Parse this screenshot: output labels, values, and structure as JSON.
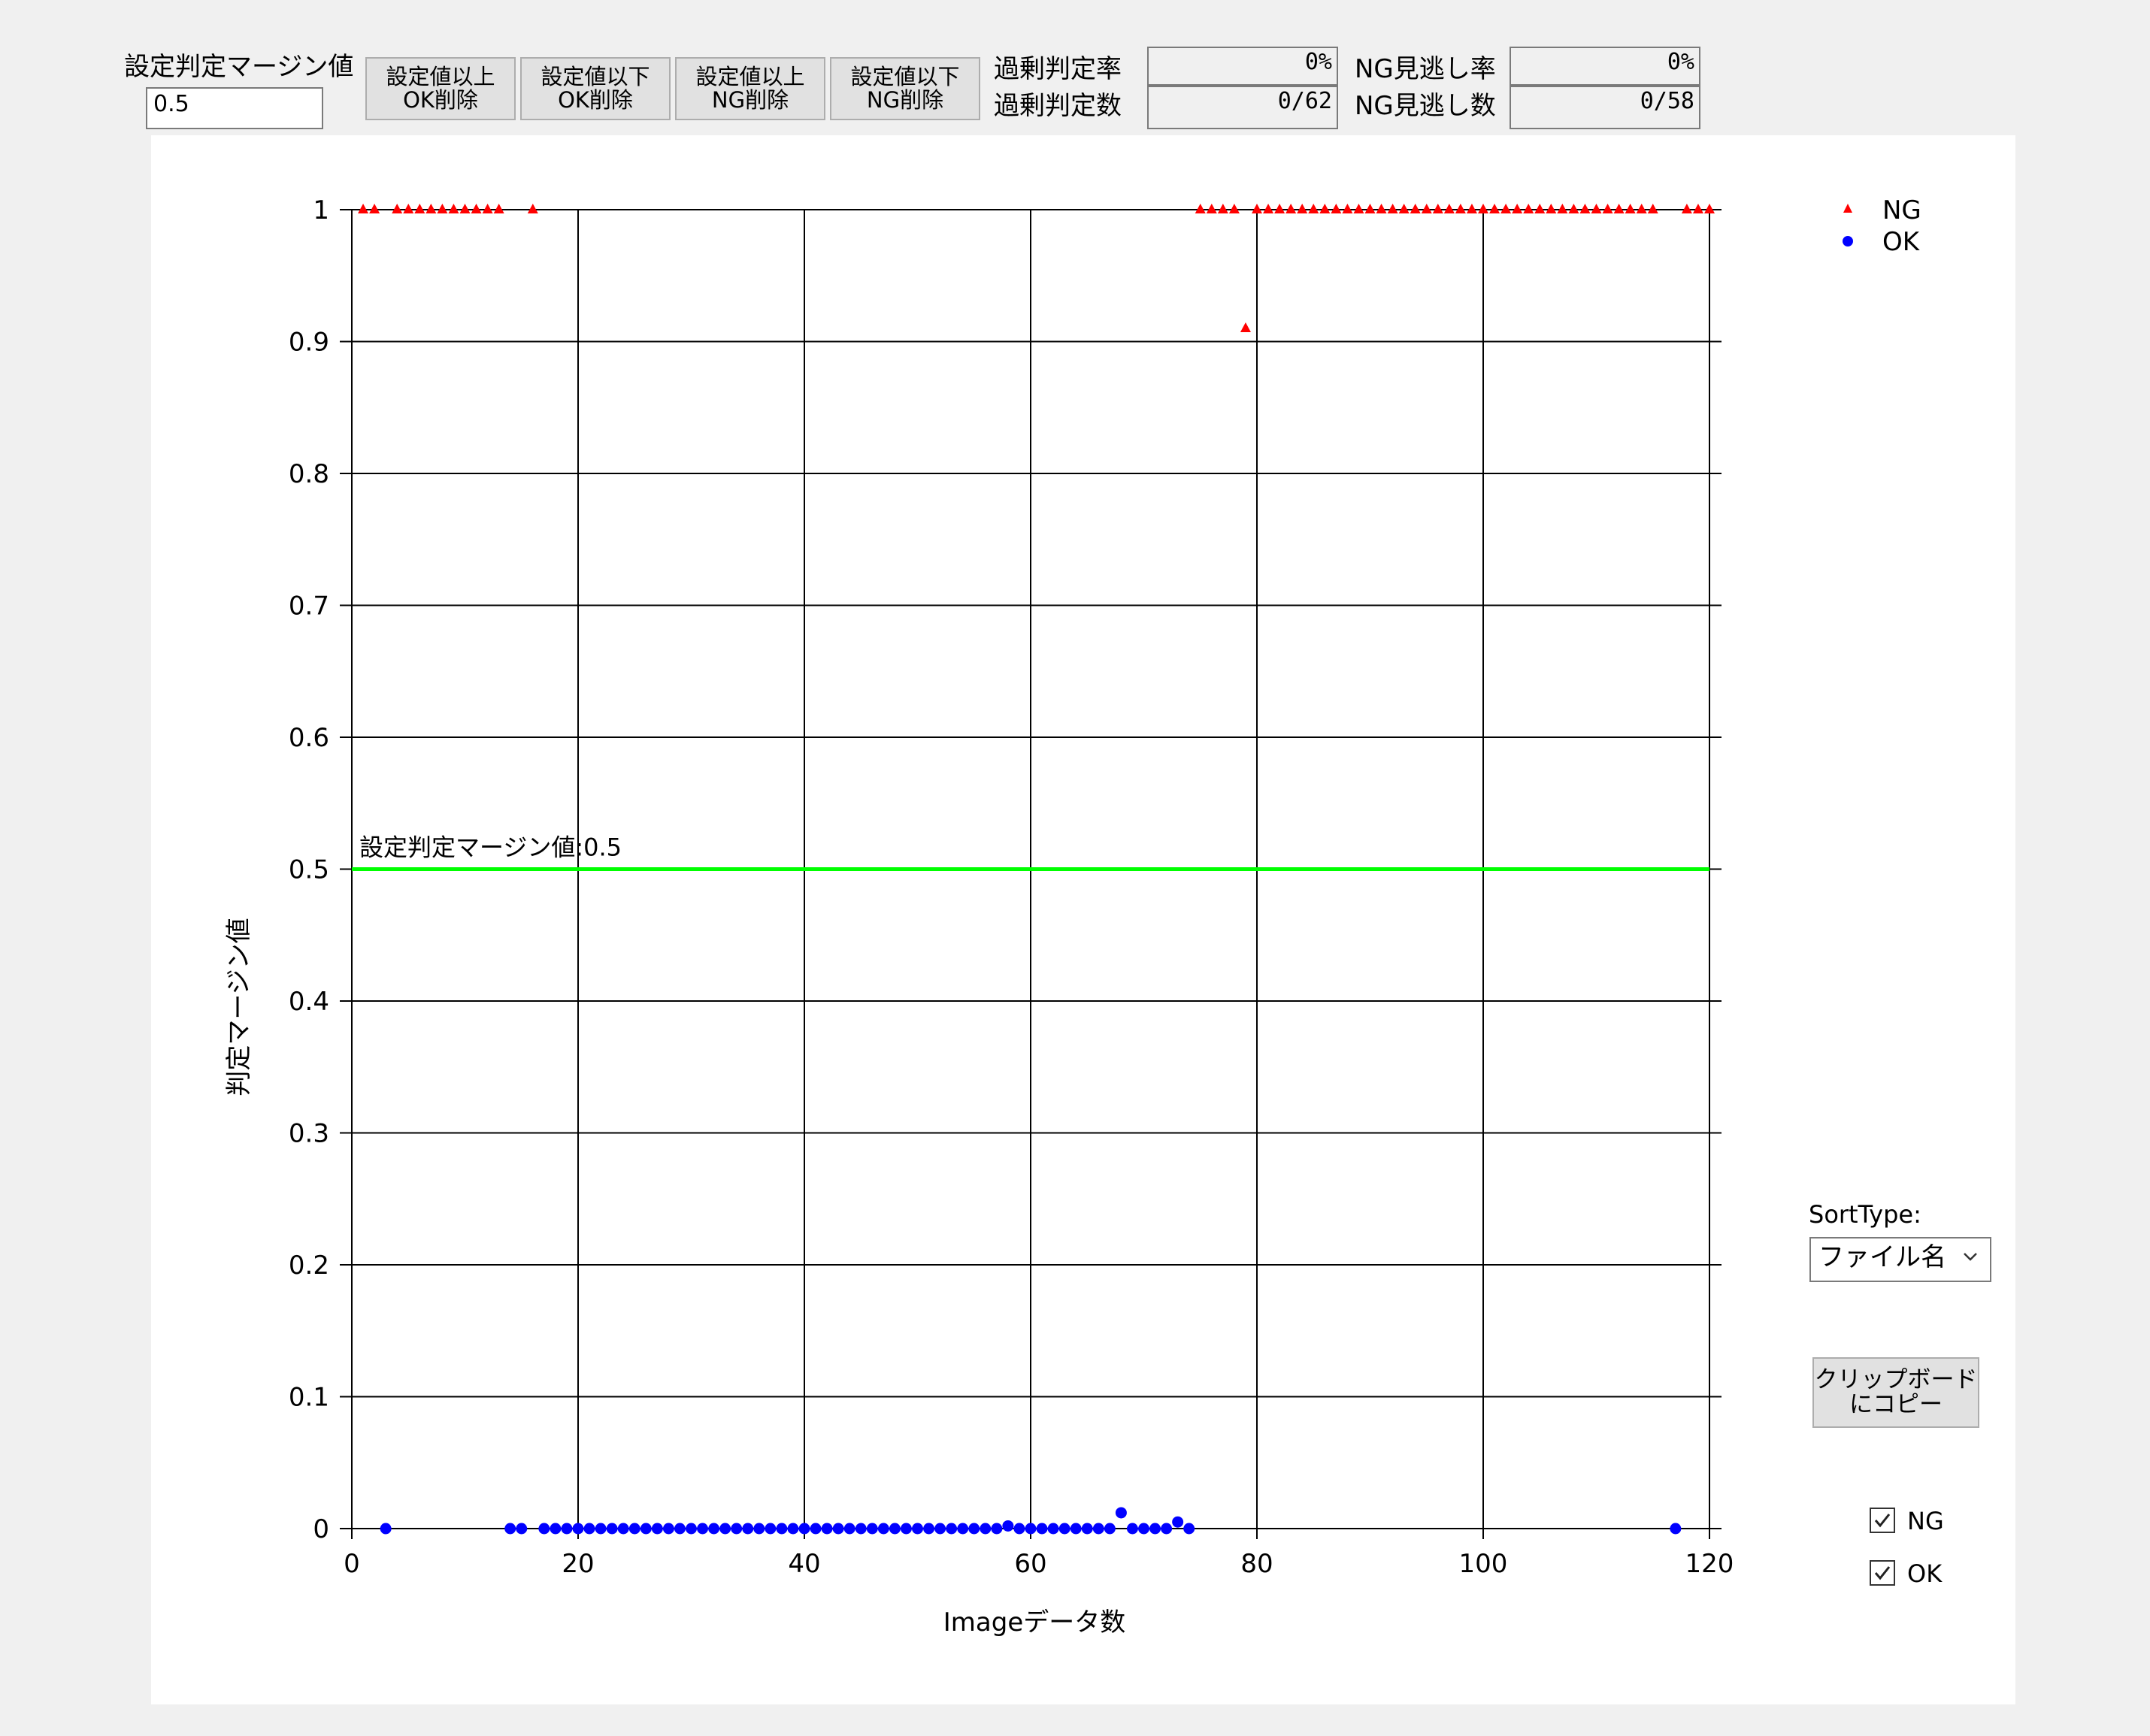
{
  "toolbar": {
    "margin_label": "設定判定マージン値",
    "margin_value": "0.5",
    "buttons": [
      {
        "line1": "設定値以上",
        "line2": "OK削除"
      },
      {
        "line1": "設定値以下",
        "line2": "OK削除"
      },
      {
        "line1": "設定値以上",
        "line2": "NG削除"
      },
      {
        "line1": "設定値以下",
        "line2": "NG削除"
      }
    ],
    "over_rate_label": "過剰判定率",
    "over_rate_value": "0%",
    "over_count_label": "過剰判定数",
    "over_count_value": "0/62",
    "miss_rate_label": "NG見逃し率",
    "miss_rate_value": "0%",
    "miss_count_label": "NG見逃し数",
    "miss_count_value": "0/58"
  },
  "side": {
    "sort_label": "SortType:",
    "sort_value": "ファイル名",
    "copy_line1": "クリップボード",
    "copy_line2": "にコピー",
    "check_ng_label": "NG",
    "check_ok_label": "OK",
    "check_ng": true,
    "check_ok": true
  },
  "colors": {
    "ng": "#ff0000",
    "ok": "#0000ff",
    "threshold": "#00ff00"
  },
  "chart_data": {
    "type": "scatter",
    "xlabel": "Imageデータ数",
    "ylabel": "判定マージン値",
    "xlim": [
      0,
      120
    ],
    "ylim": [
      0,
      1
    ],
    "xticks": [
      0,
      20,
      40,
      60,
      80,
      100,
      120
    ],
    "yticks": [
      0,
      0.1,
      0.2,
      0.3,
      0.4,
      0.5,
      0.6,
      0.7,
      0.8,
      0.9,
      1
    ],
    "ytick_labels": [
      "0",
      "0.1",
      "0.2",
      "0.3",
      "0.4",
      "0.5",
      "0.6",
      "0.7",
      "0.8",
      "0.9",
      "1"
    ],
    "grid": true,
    "legend_position": "top-right",
    "threshold_value": 0.5,
    "threshold_label": "設定判定マージン値:0.5",
    "series": [
      {
        "name": "NG",
        "marker": "triangle",
        "points": [
          [
            1,
            1
          ],
          [
            2,
            1
          ],
          [
            4,
            1
          ],
          [
            5,
            1
          ],
          [
            6,
            1
          ],
          [
            7,
            1
          ],
          [
            8,
            1
          ],
          [
            9,
            1
          ],
          [
            10,
            1
          ],
          [
            11,
            1
          ],
          [
            12,
            1
          ],
          [
            13,
            1
          ],
          [
            16,
            1
          ],
          [
            75,
            1
          ],
          [
            76,
            1
          ],
          [
            77,
            1
          ],
          [
            78,
            1
          ],
          [
            79,
            0.91
          ],
          [
            80,
            1
          ],
          [
            81,
            1
          ],
          [
            82,
            1
          ],
          [
            83,
            1
          ],
          [
            84,
            1
          ],
          [
            85,
            1
          ],
          [
            86,
            1
          ],
          [
            87,
            1
          ],
          [
            88,
            1
          ],
          [
            89,
            1
          ],
          [
            90,
            1
          ],
          [
            91,
            1
          ],
          [
            92,
            1
          ],
          [
            93,
            1
          ],
          [
            94,
            1
          ],
          [
            95,
            1
          ],
          [
            96,
            1
          ],
          [
            97,
            1
          ],
          [
            98,
            1
          ],
          [
            99,
            1
          ],
          [
            100,
            1
          ],
          [
            101,
            1
          ],
          [
            102,
            1
          ],
          [
            103,
            1
          ],
          [
            104,
            1
          ],
          [
            105,
            1
          ],
          [
            106,
            1
          ],
          [
            107,
            1
          ],
          [
            108,
            1
          ],
          [
            109,
            1
          ],
          [
            110,
            1
          ],
          [
            111,
            1
          ],
          [
            112,
            1
          ],
          [
            113,
            1
          ],
          [
            114,
            1
          ],
          [
            115,
            1
          ],
          [
            118,
            1
          ],
          [
            119,
            1
          ],
          [
            120,
            1
          ]
        ]
      },
      {
        "name": "OK",
        "marker": "circle",
        "points": [
          [
            3,
            0
          ],
          [
            14,
            0
          ],
          [
            15,
            0
          ],
          [
            17,
            0
          ],
          [
            18,
            0
          ],
          [
            19,
            0
          ],
          [
            20,
            0
          ],
          [
            21,
            0
          ],
          [
            22,
            0
          ],
          [
            23,
            0
          ],
          [
            24,
            0
          ],
          [
            25,
            0
          ],
          [
            26,
            0
          ],
          [
            27,
            0
          ],
          [
            28,
            0
          ],
          [
            29,
            0
          ],
          [
            30,
            0
          ],
          [
            31,
            0
          ],
          [
            32,
            0
          ],
          [
            33,
            0
          ],
          [
            34,
            0
          ],
          [
            35,
            0
          ],
          [
            36,
            0
          ],
          [
            37,
            0
          ],
          [
            38,
            0
          ],
          [
            39,
            0
          ],
          [
            40,
            0
          ],
          [
            41,
            0
          ],
          [
            42,
            0
          ],
          [
            43,
            0
          ],
          [
            44,
            0
          ],
          [
            45,
            0
          ],
          [
            46,
            0
          ],
          [
            47,
            0
          ],
          [
            48,
            0
          ],
          [
            49,
            0
          ],
          [
            50,
            0
          ],
          [
            51,
            0
          ],
          [
            52,
            0
          ],
          [
            53,
            0
          ],
          [
            54,
            0
          ],
          [
            55,
            0
          ],
          [
            56,
            0
          ],
          [
            57,
            0
          ],
          [
            58,
            0.002
          ],
          [
            59,
            0
          ],
          [
            60,
            0
          ],
          [
            61,
            0
          ],
          [
            62,
            0
          ],
          [
            63,
            0
          ],
          [
            64,
            0
          ],
          [
            65,
            0
          ],
          [
            66,
            0
          ],
          [
            67,
            0
          ],
          [
            68,
            0.012
          ],
          [
            69,
            0
          ],
          [
            70,
            0
          ],
          [
            71,
            0
          ],
          [
            72,
            0
          ],
          [
            73,
            0.005
          ],
          [
            74,
            0
          ],
          [
            117,
            0
          ]
        ]
      }
    ]
  }
}
